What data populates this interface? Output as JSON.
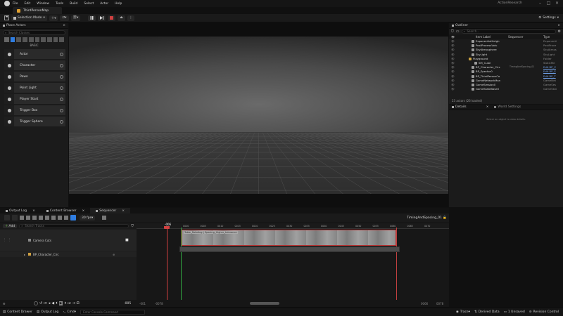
{
  "menubar": {
    "items": [
      "File",
      "Edit",
      "Window",
      "Tools",
      "Build",
      "Select",
      "Actor",
      "Help"
    ],
    "project_name": "ActionResearch"
  },
  "level_tab": {
    "label": "ThirdPersonMap"
  },
  "toolbar": {
    "mode_label": "Selection Mode",
    "settings_label": "Settings"
  },
  "place_actors": {
    "tab_label": "Place Actors",
    "search_placeholder": "Search Classes",
    "category_label": "BASIC",
    "items": [
      {
        "label": "Actor",
        "icon": "actor-icon"
      },
      {
        "label": "Character",
        "icon": "character-icon"
      },
      {
        "label": "Pawn",
        "icon": "pawn-icon"
      },
      {
        "label": "Point Light",
        "icon": "point-light-icon"
      },
      {
        "label": "Player Start",
        "icon": "player-start-icon"
      },
      {
        "label": "Trigger Box",
        "icon": "trigger-box-icon"
      },
      {
        "label": "Trigger Sphere",
        "icon": "trigger-sphere-icon"
      }
    ]
  },
  "outliner": {
    "tab_label": "Outliner",
    "search_placeholder": "Search...",
    "col_item": "Item Label",
    "col_seq": "Sequencer",
    "col_type": "Type",
    "rows": [
      {
        "name": "ExponentialHeigh",
        "type": "Exponenti",
        "link": false,
        "indent": 0
      },
      {
        "name": "PostProcessVolu",
        "type": "PostProce",
        "link": false,
        "indent": 0
      },
      {
        "name": "SkyAtmosphere",
        "type": "SkyAtmos",
        "link": false,
        "indent": 0
      },
      {
        "name": "SkyLight",
        "type": "SkyLight",
        "link": false,
        "indent": 0
      },
      {
        "name": "Playground",
        "type": "Folder",
        "link": false,
        "indent": -1
      },
      {
        "name": "SM_Cube",
        "type": "StaticMe",
        "link": false,
        "indent": 1
      },
      {
        "name": "BP_Character_Circ",
        "type": "Edit BP_C",
        "link": true,
        "indent": 0,
        "extra": "TimingAndSpacing_01"
      },
      {
        "name": "BP_Spector0",
        "type": "Edit BP_S",
        "link": true,
        "indent": 0
      },
      {
        "name": "BP_ThirdPersonCo",
        "type": "Edit BP_T",
        "link": true,
        "indent": 0
      },
      {
        "name": "GameNetworkMan",
        "type": "GameNet",
        "link": false,
        "indent": 0
      },
      {
        "name": "GameSession0",
        "type": "GameSes",
        "link": false,
        "indent": 0
      },
      {
        "name": "GameStateBase0",
        "type": "GameStat",
        "link": false,
        "indent": 0
      }
    ],
    "footer": "23 actors (26 loaded)"
  },
  "details": {
    "tab_label": "Details",
    "world_settings_label": "World Settings",
    "empty_hint": "Select an object to view details."
  },
  "bottom_tabs": [
    "Output Log",
    "Content Browser",
    "Sequencer"
  ],
  "sequencer": {
    "fps_label": "30 fps",
    "current_frame": "-0006",
    "sequence_name": "TimingAndSpacing_01",
    "add_label": "Add",
    "search_placeholder": "Search Tracks",
    "tracks": [
      {
        "label": "Camera Cuts",
        "icon": "camera-cuts-icon"
      },
      {
        "label": "BP_Character_Circ",
        "icon": "actor-track-icon"
      }
    ],
    "ruler_labels": [
      "0000",
      "0005",
      "0010",
      "0015",
      "0020",
      "0025",
      "0030",
      "0035",
      "0040",
      "0045",
      "0050",
      "0055",
      "0060",
      "0065",
      "0070"
    ],
    "ruler_left": "-006",
    "section_label": "Table_Rotating | Spacing_Higher_tolerance",
    "frame_field": "-005",
    "range_start": "-001",
    "range_view_start": "-0078",
    "range_end": "0066",
    "range_view_end": "0078"
  },
  "statusbar": {
    "content_drawer": "Content Drawer",
    "output_log": "Output Log",
    "cmd": "Cmd",
    "cmd_placeholder": "Enter Console Command",
    "trace": "Trace",
    "derived_data": "Derived Data",
    "unsaved": "1 Unsaved",
    "revision_control": "Revision Control"
  },
  "colors": {
    "accent_blue": "#2f7de1",
    "playhead_red": "#d04040",
    "link_blue": "#6fa0e8"
  }
}
